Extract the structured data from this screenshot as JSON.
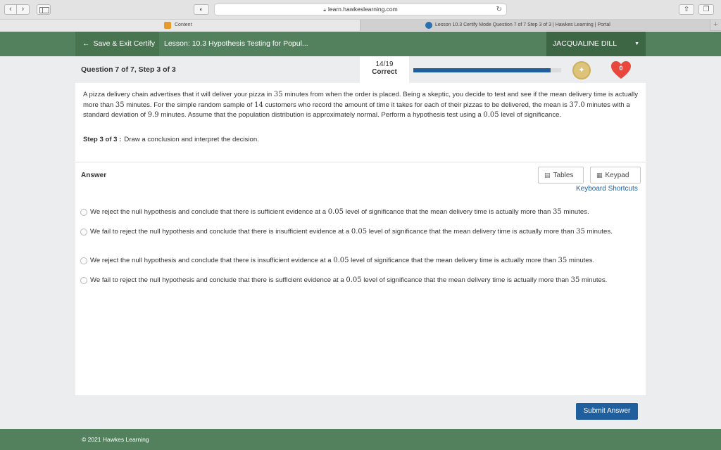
{
  "browser": {
    "url": "learn.hawkeslearning.com",
    "tabs": [
      {
        "label": "Content"
      },
      {
        "label": "Lesson 10.3 Certify Mode Question 7 of 7 Step 3 of 3 | Hawkes Learning | Portal"
      }
    ]
  },
  "header": {
    "exit_label": "Save & Exit Certify",
    "lesson_title": "Lesson: 10.3 Hypothesis Testing for Popul...",
    "user_name": "JACQUALINE DILL"
  },
  "progress": {
    "question_label": "Question 7 of 7, Step 3 of 3",
    "score": "14/19",
    "score_label": "Correct",
    "bar_fraction": 0.93,
    "hearts": "0"
  },
  "question": {
    "text_1": "A pizza delivery chain advertises that it will deliver your pizza in ",
    "n1": "35",
    "text_2": " minutes from when the order is placed. Being a skeptic, you decide to test and see if the mean delivery time is actually more than ",
    "n2": "35",
    "text_3": " minutes. For the simple random sample of ",
    "n3": "14",
    "text_4": " customers who record the amount of time it takes for each of their pizzas to be delivered, the mean is ",
    "n4": "37.0",
    "text_5": " minutes with a standard deviation of ",
    "n5": "9.9",
    "text_6": " minutes. Assume that the population distribution is approximately normal. Perform a hypothesis test using a ",
    "n6": "0.05",
    "text_7": " level of significance.",
    "step_label": "Step 3 of 3 :",
    "step_text": "Draw a conclusion and interpret the decision."
  },
  "answer": {
    "label": "Answer",
    "tables_label": "Tables",
    "keypad_label": "Keypad",
    "shortcuts_label": "Keyboard Shortcuts",
    "options": [
      {
        "a": "We reject the null hypothesis and conclude that there is sufficient evidence at a ",
        "alpha": "0.05",
        "b": " level of significance that the mean delivery time is actually more than ",
        "n": "35",
        "c": " minutes."
      },
      {
        "a": "We fail to reject the null hypothesis and conclude that there is insufficient evidence at a ",
        "alpha": "0.05",
        "b": " level of significance that the mean delivery time is actually more than ",
        "n": "35",
        "c": " minutes."
      },
      {
        "a": "We reject the null hypothesis and conclude that there is insufficient evidence at a ",
        "alpha": "0.05",
        "b": " level of significance that the mean delivery time is actually more than ",
        "n": "35",
        "c": " minutes."
      },
      {
        "a": "We fail to reject the null hypothesis and conclude that there is sufficient evidence at a ",
        "alpha": "0.05",
        "b": " level of significance that the mean delivery time is actually more than ",
        "n": "35",
        "c": " minutes."
      }
    ],
    "submit_label": "Submit Answer"
  },
  "footer": {
    "copyright": "© 2021 Hawkes Learning"
  },
  "colors": {
    "header_green": "#53815e",
    "primary_blue": "#1f5f9e",
    "heart_red": "#e8473e",
    "coin_gold": "#ddc47a"
  },
  "icons": {
    "back": "chevron-left-icon",
    "forward": "chevron-right-icon",
    "sidebar": "sidebar-icon",
    "shield": "shield-icon",
    "lock": "lock-icon",
    "reload": "reload-icon",
    "share": "share-icon",
    "tabs": "tabs-icon",
    "exit": "arrow-left-icon",
    "dropdown": "caret-down-icon",
    "coin": "coin-icon",
    "heart": "heart-icon",
    "tables": "table-icon",
    "keypad": "keypad-icon"
  }
}
